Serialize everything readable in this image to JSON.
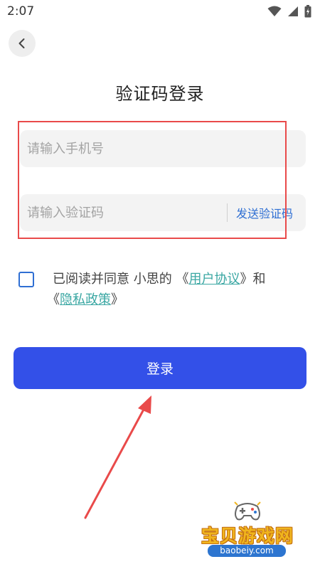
{
  "status_bar": {
    "time": "2:07"
  },
  "page": {
    "title": "验证码登录"
  },
  "phone_field": {
    "placeholder": "请输入手机号",
    "value": ""
  },
  "code_field": {
    "placeholder": "请输入验证码",
    "value": "",
    "send_label": "发送验证码"
  },
  "agreement": {
    "prefix": "已阅读并同意 小思的 《",
    "user_agreement": "用户协议",
    "middle": "》和",
    "line2_prefix": "《",
    "privacy_policy": "隐私政策",
    "suffix": "》",
    "checked": false
  },
  "login_button": {
    "label": "登录"
  },
  "watermark": {
    "name": "宝贝游戏网",
    "url": "baobeiy.com"
  },
  "colors": {
    "primary": "#3350e8",
    "link": "#3aa7a3",
    "send_code": "#2f6fd3",
    "annotation_red": "#e94a4a",
    "field_bg": "#f3f3f3"
  },
  "icons": {
    "back": "chevron-left-icon",
    "wifi": "wifi-icon",
    "signal": "signal-icon",
    "battery": "battery-icon"
  }
}
